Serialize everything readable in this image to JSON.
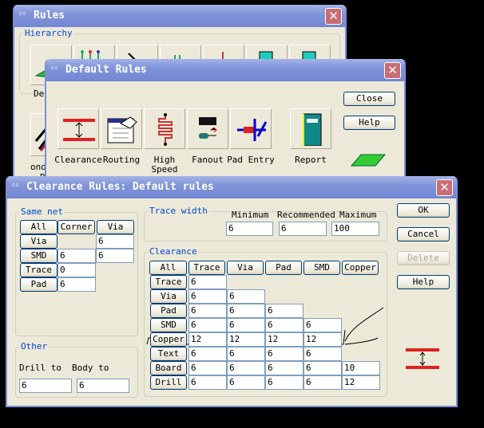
{
  "rules_window": {
    "title": "Rules",
    "hierarchy_label": "Hierarchy",
    "partial_label_1": "De",
    "partial_label_2": "ondi",
    "partial_label_3": "Ru"
  },
  "default_rules": {
    "title": "Default Rules",
    "buttons": [
      {
        "label": "Clearance"
      },
      {
        "label": "Routing"
      },
      {
        "label": "High Speed"
      },
      {
        "label": "Fanout"
      },
      {
        "label": "Pad Entry"
      },
      {
        "label": "Report"
      }
    ],
    "close": "Close",
    "help": "Help"
  },
  "clearance": {
    "title": "Clearance Rules: Default rules",
    "same_net": {
      "label": "Same net",
      "headers": [
        "All",
        "Corner",
        "Via"
      ],
      "rows": [
        {
          "label": "Via",
          "corner": "",
          "via": "6"
        },
        {
          "label": "SMD",
          "corner": "6",
          "via": "6"
        },
        {
          "label": "Trace",
          "corner": "0",
          "via": null
        },
        {
          "label": "Pad",
          "corner": "6",
          "via": null
        }
      ]
    },
    "other": {
      "label": "Other",
      "drill_label": "Drill to",
      "body_label": "Body to",
      "drill": "6",
      "body": "6"
    },
    "trace_width": {
      "label": "Trace width",
      "min_label": "Minimum",
      "rec_label": "Recommended",
      "max_label": "Maximum",
      "min": "6",
      "rec": "6",
      "max": "100"
    },
    "grid": {
      "label": "Clearance",
      "headers": [
        "All",
        "Trace",
        "Via",
        "Pad",
        "SMD",
        "Copper"
      ],
      "rows": [
        {
          "label": "Trace",
          "values": [
            "6"
          ]
        },
        {
          "label": "Via",
          "values": [
            "6",
            "6"
          ]
        },
        {
          "label": "Pad",
          "values": [
            "6",
            "6",
            "6"
          ]
        },
        {
          "label": "SMD",
          "values": [
            "6",
            "6",
            "6",
            "6"
          ]
        },
        {
          "label": "Copper",
          "values": [
            "12",
            "12",
            "12",
            "12"
          ]
        },
        {
          "label": "Text",
          "values": [
            "6",
            "6",
            "6",
            "6"
          ]
        },
        {
          "label": "Board",
          "values": [
            "6",
            "6",
            "6",
            "6",
            "10"
          ]
        },
        {
          "label": "Drill",
          "values": [
            "6",
            "6",
            "6",
            "6",
            "12"
          ]
        }
      ]
    },
    "buttons": {
      "ok": "OK",
      "cancel": "Cancel",
      "delete": "Delete",
      "help": "Help"
    }
  }
}
